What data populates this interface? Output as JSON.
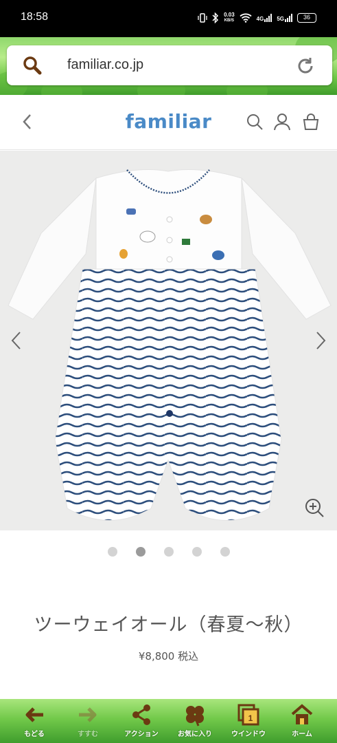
{
  "status_bar": {
    "time": "18:58",
    "speed_value": "0.03",
    "speed_unit": "KB/S",
    "net1": "4G",
    "net2": "5G",
    "battery": "36"
  },
  "browser": {
    "url": "familiar.co.jp"
  },
  "site_header": {
    "logo": "familiar",
    "logo_color": "#4a8ac7"
  },
  "gallery": {
    "image_icon": "striped-baby-romper-photo",
    "dot_count": 5,
    "active_dot_index": 1
  },
  "product": {
    "title": "ツーウェイオール（春夏～秋）",
    "price": "¥8,800 税込"
  },
  "toolbar": {
    "items": [
      {
        "label": "もどる",
        "icon": "arrow-left-icon"
      },
      {
        "label": "すすむ",
        "icon": "arrow-right-icon"
      },
      {
        "label": "アクション",
        "icon": "share-icon"
      },
      {
        "label": "お気に入り",
        "icon": "clover-icon"
      },
      {
        "label": "ウインドウ",
        "icon": "window-icon",
        "count": "1"
      },
      {
        "label": "ホーム",
        "icon": "home-icon"
      }
    ]
  }
}
